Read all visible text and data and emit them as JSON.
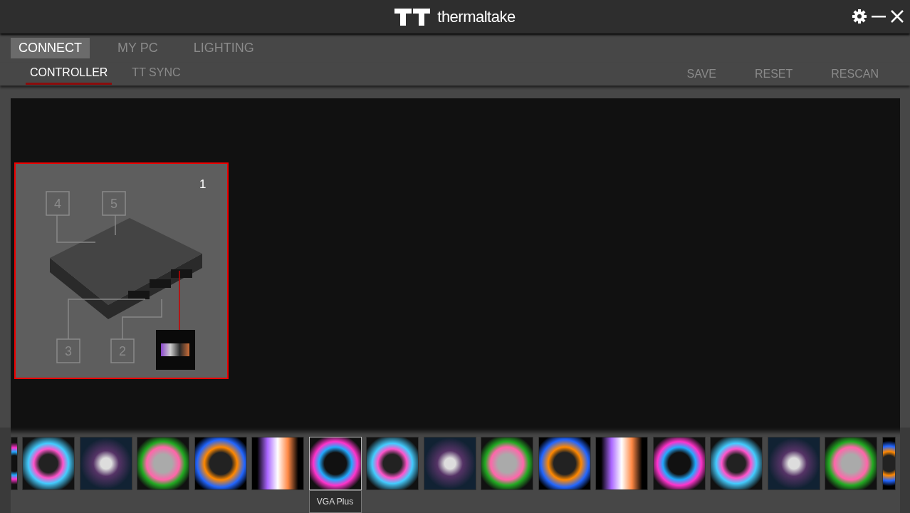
{
  "app": {
    "logo_text": "thermaltake"
  },
  "main_tabs": [
    {
      "label": "CONNECT",
      "selected": true
    },
    {
      "label": "MY PC",
      "selected": false
    },
    {
      "label": "LIGHTING",
      "selected": false
    }
  ],
  "sub_tabs": [
    {
      "label": "CONTROLLER",
      "selected": true
    },
    {
      "label": "TT SYNC",
      "selected": false
    }
  ],
  "actions": [
    "SAVE",
    "RESET",
    "RESCAN"
  ],
  "controller": {
    "number": "1",
    "selected": true,
    "ports": [
      {
        "label": "4"
      },
      {
        "label": "5"
      },
      {
        "label": "3"
      },
      {
        "label": "2"
      }
    ]
  },
  "products": [
    {
      "hovered": false
    },
    {
      "hovered": false
    },
    {
      "hovered": false
    },
    {
      "hovered": false
    },
    {
      "hovered": false
    },
    {
      "hovered": false
    },
    {
      "hovered": true
    },
    {
      "hovered": false
    },
    {
      "hovered": false
    },
    {
      "hovered": false
    },
    {
      "hovered": false
    },
    {
      "hovered": false
    },
    {
      "hovered": false
    },
    {
      "hovered": false
    },
    {
      "hovered": false
    },
    {
      "hovered": false
    },
    {
      "hovered": false
    }
  ],
  "tooltip": {
    "text": "VGA Plus"
  }
}
